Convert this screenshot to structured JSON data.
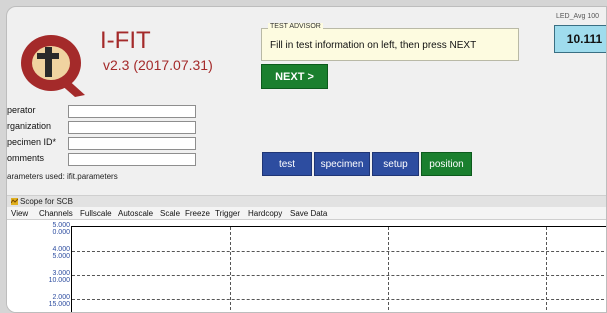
{
  "app": {
    "name": "I-FIT",
    "version": "v2.3 (2017.07.31)"
  },
  "advisor": {
    "title": "TEST ADVISOR",
    "message": "Fill in test information on left, then press NEXT"
  },
  "next_button": "NEXT >",
  "led": {
    "label": "LED_Avg 100",
    "value": "10.111"
  },
  "form": {
    "operator_label": "perator",
    "organization_label": "rganization",
    "specimen_label": "pecimen ID*",
    "comments_label": "omments",
    "params_used": "arameters used: ifit.parameters"
  },
  "tabs": [
    "test",
    "specimen",
    "setup",
    "position"
  ],
  "scope": {
    "title": "Scope for SCB",
    "menu": [
      "View",
      "Channels",
      "Fullscale",
      "Autoscale",
      "Scale",
      "Freeze",
      "Trigger",
      "Hardcopy",
      "Save Data"
    ],
    "y_labels": [
      {
        "top": "5.000",
        "bottom": "0.000"
      },
      {
        "top": "4.000",
        "bottom": "5.000"
      },
      {
        "top": "3.000",
        "bottom": "10.000"
      },
      {
        "top": "2.000",
        "bottom": "15.000"
      }
    ]
  }
}
